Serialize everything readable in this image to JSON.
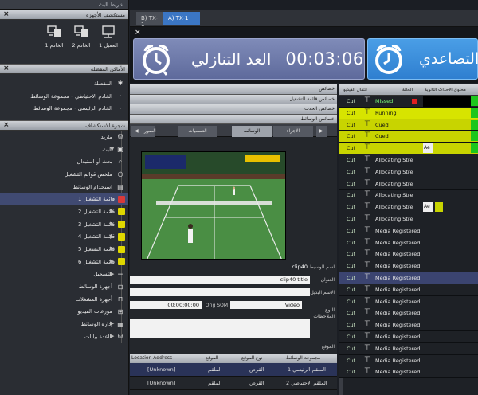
{
  "sidebar": {
    "title": "شريط البث",
    "devices_panel": "مستكشف الأجهزة",
    "devices": [
      {
        "label": "الخادم 1",
        "icon": "server-icon"
      },
      {
        "label": "الخادم 2",
        "icon": "server-icon"
      },
      {
        "label": "العميل 1",
        "icon": "workstation-icon"
      }
    ],
    "favorites_panel": "الأماكن المفضلة",
    "favorites": [
      "المفضلة",
      "الخادم الاحتياطي - مجموعة الوسائط",
      "الخادم الرئيسي - مجموعة الوسائط"
    ],
    "tree_panel": "شجرة الاستكشاف",
    "tree": [
      {
        "label": "ماريدا"
      },
      {
        "label": "البث"
      },
      {
        "label": "بحث أو استبدال"
      },
      {
        "label": "ملخص قوائم التشغيل"
      },
      {
        "label": "استخدام الوسائط"
      },
      {
        "label": "قائمة التشغيل 1"
      },
      {
        "label": "قائمة التشغيل 2"
      },
      {
        "label": "قائمة التشغيل 3"
      },
      {
        "label": "قائمة التشغيل 4"
      },
      {
        "label": "قائمة التشغيل 5"
      },
      {
        "label": "قائمة التشغيل 6"
      },
      {
        "label": "التسجيل"
      },
      {
        "label": "أجهزة الوسائط"
      },
      {
        "label": "أجهزة المشغلات"
      },
      {
        "label": "موزعات الفيديو"
      },
      {
        "label": "إدارة الوسائط"
      },
      {
        "label": "قاعدة بيانات"
      }
    ]
  },
  "tabs": [
    {
      "label": "B) TX-1"
    },
    {
      "label": "A) TX-1"
    }
  ],
  "clocks": {
    "countdown_time": "00:03:06",
    "countdown_label": "العد التنازلي",
    "countup_label": "التصاعدي"
  },
  "mid": {
    "header_buttons": [
      "خصائص",
      "خصائص قائمة التشغيل",
      "خصائص الحدث",
      "خصائص الوسائط"
    ],
    "subtabs": [
      "الأجزاء",
      "الوسائط",
      "التسميات",
      "الصور"
    ],
    "fields": {
      "media_name_label": "اسم الوسيط",
      "media_name": "clip40",
      "title_label": "العنوان",
      "title": "clip40 title",
      "alt_name_label": "الاسم البديل",
      "type_label": "النوع",
      "type": "Video",
      "som_label": "Orig SOM",
      "som": "00:00:00:00",
      "notes_label": "الملاحظات",
      "location_label": "الموقع"
    },
    "location_table": {
      "headers": [
        "مجموعة الوسائط",
        "نوع الموقع",
        "الموقع",
        "Location Address"
      ],
      "rows": [
        [
          "الملقم الرئيسي 1",
          "القرص",
          "الملقم",
          "[Unknown]"
        ],
        [
          "الملقم الاحتياطي 2",
          "القرص",
          "الملقم",
          "[Unknown]"
        ]
      ]
    }
  },
  "playlist": {
    "headers": [
      "انتقال الفيديو",
      "الحالة",
      "محتوى الأحداث الثانوية"
    ],
    "rows": [
      {
        "transition": "Cut",
        "status": "Missed",
        "style": "missed"
      },
      {
        "transition": "Cut",
        "status": "Running",
        "style": "running"
      },
      {
        "transition": "Cut",
        "status": "Cued",
        "style": "cued"
      },
      {
        "transition": "Cut",
        "status": "Cued",
        "style": "cued"
      },
      {
        "transition": "Cut",
        "status": "",
        "style": "cued-empty",
        "secondary": "Ae"
      },
      {
        "transition": "Cut",
        "status": "Allocating Stre",
        "style": "normal"
      },
      {
        "transition": "Cut",
        "status": "Allocating Stre",
        "style": "normal"
      },
      {
        "transition": "Cut",
        "status": "Allocating Stre",
        "style": "normal"
      },
      {
        "transition": "Cut",
        "status": "Allocating Stre",
        "style": "normal"
      },
      {
        "transition": "Cut",
        "status": "Allocating Stre",
        "style": "normal",
        "secondary": "Ae"
      },
      {
        "transition": "Cut",
        "status": "Allocating Stre",
        "style": "normal"
      },
      {
        "transition": "Cut",
        "status": "Media Registered",
        "style": "normal"
      },
      {
        "transition": "Cut",
        "status": "Media Registered",
        "style": "normal"
      },
      {
        "transition": "Cut",
        "status": "Media Registered",
        "style": "normal"
      },
      {
        "transition": "Cut",
        "status": "Media Registered",
        "style": "normal"
      },
      {
        "transition": "Cut",
        "status": "Media Registered",
        "style": "selected"
      },
      {
        "transition": "Cut",
        "status": "Media Registered",
        "style": "normal"
      },
      {
        "transition": "Cut",
        "status": "Media Registered",
        "style": "normal"
      },
      {
        "transition": "Cut",
        "status": "Media Registered",
        "style": "normal"
      },
      {
        "transition": "Cut",
        "status": "Media Registered",
        "style": "normal"
      },
      {
        "transition": "Cut",
        "status": "Media Registered",
        "style": "normal"
      },
      {
        "transition": "Cut",
        "status": "Media Registered",
        "style": "normal"
      },
      {
        "transition": "Cut",
        "status": "Media Registered",
        "style": "normal"
      },
      {
        "transition": "Cut",
        "status": "Media Registered",
        "style": "normal"
      }
    ]
  },
  "colors": {
    "cued": "#c8d400",
    "running": "#d7e400",
    "selected": "#3b4470",
    "countdown": "#6c78aa",
    "countup": "#3f8fdd"
  }
}
